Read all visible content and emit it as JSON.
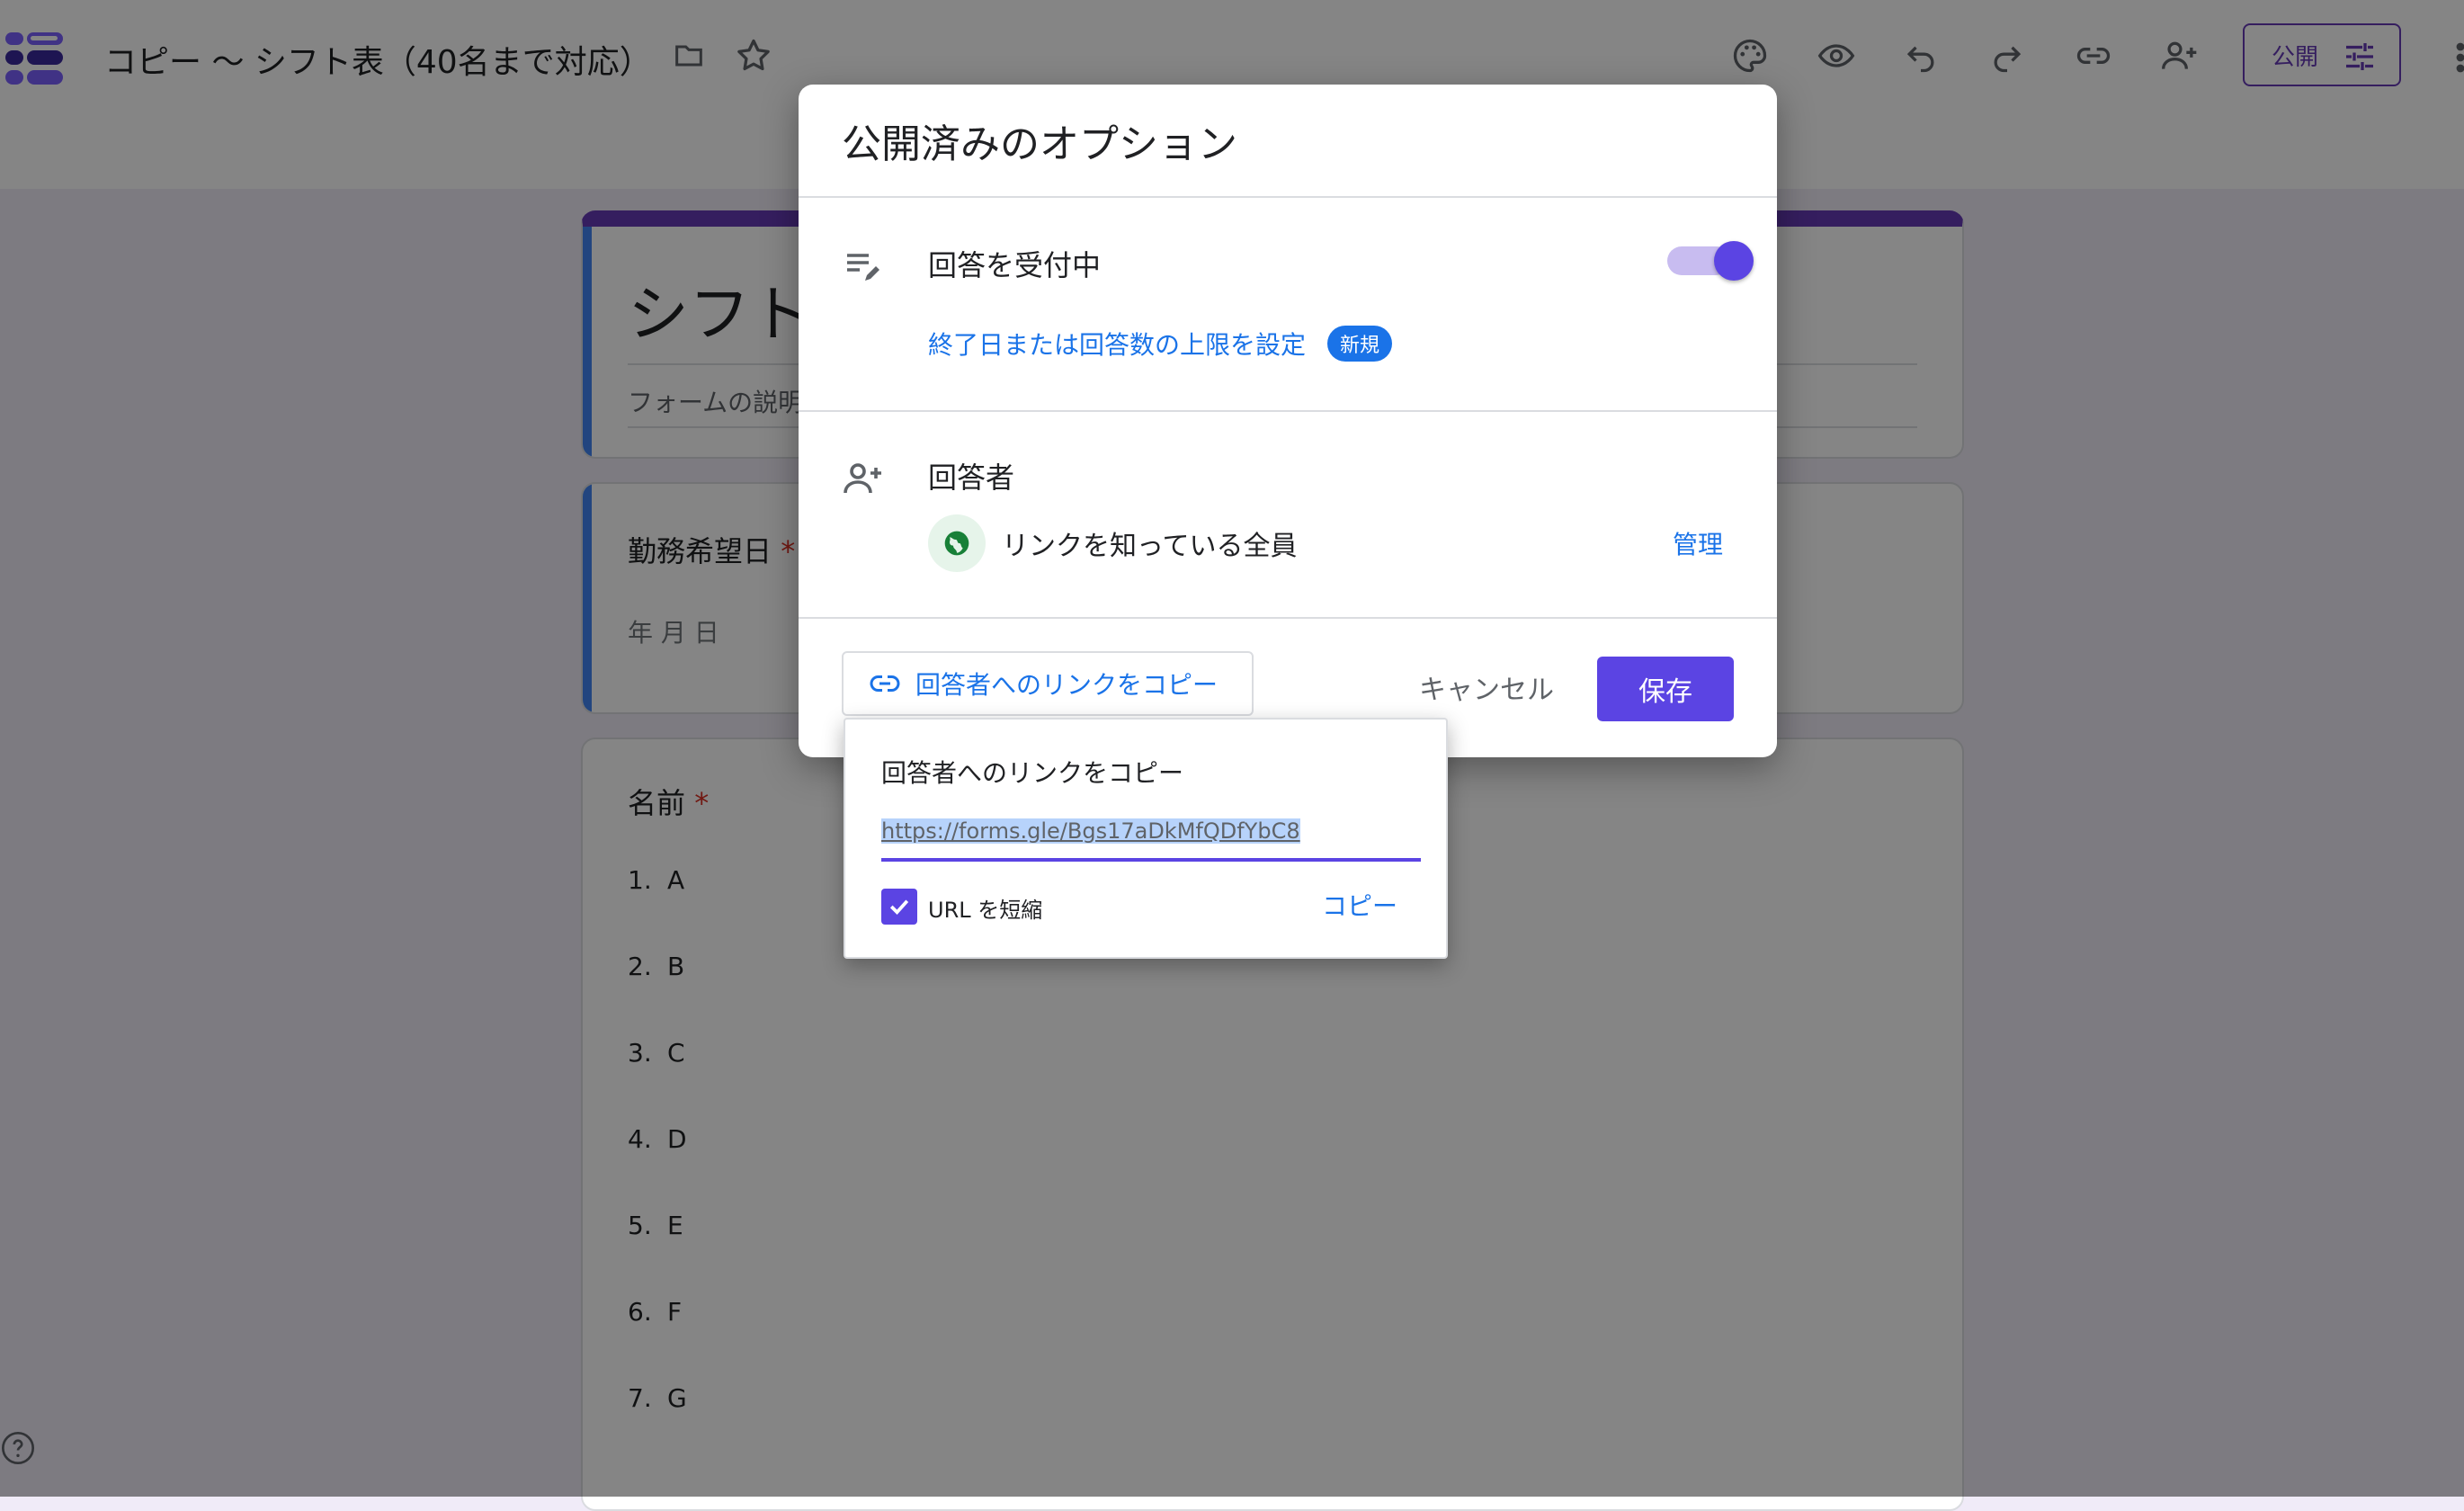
{
  "app": {
    "doc_title": "コピー 〜 シフト表（40名まで対応）",
    "publish_label": "公開"
  },
  "toolbar": {
    "icons": [
      "folder-icon",
      "star-icon",
      "palette-icon",
      "preview-eye-icon",
      "undo-icon",
      "redo-icon",
      "link-icon",
      "add-collaborator-icon",
      "more-vert-icon"
    ]
  },
  "form": {
    "title_partial": "シフト",
    "description_partial": "フォームの説明",
    "questions": [
      {
        "title": "勤務希望日",
        "required_mark": "*",
        "placeholder": "年 月 日"
      },
      {
        "title": "名前",
        "required_mark": "*",
        "options": [
          {
            "num": "1.",
            "label": "A"
          },
          {
            "num": "2.",
            "label": "B"
          },
          {
            "num": "3.",
            "label": "C"
          },
          {
            "num": "4.",
            "label": "D"
          },
          {
            "num": "5.",
            "label": "E"
          },
          {
            "num": "6.",
            "label": "F"
          },
          {
            "num": "7.",
            "label": "G"
          }
        ]
      }
    ]
  },
  "dialog": {
    "title": "公開済みのオプション",
    "accepting_label": "回答を受付中",
    "accepting_on": true,
    "limit_link": "終了日または回答数の上限を設定",
    "new_badge": "新規",
    "responders_label": "回答者",
    "audience": "リンクを知っている全員",
    "manage": "管理",
    "copy_link_button": "回答者へのリンクをコピー",
    "cancel": "キャンセル",
    "save": "保存"
  },
  "popover": {
    "title": "回答者へのリンクをコピー",
    "url": "https://forms.gle/Bgs17aDkMfQDfYbC8",
    "shorten_label": "URL を短縮",
    "shorten_checked": true,
    "copy": "コピー"
  },
  "colors": {
    "accent": "#5b44e3",
    "form_theme": "#673ab7",
    "link": "#1a73e8",
    "background": "#f0ebf8"
  }
}
